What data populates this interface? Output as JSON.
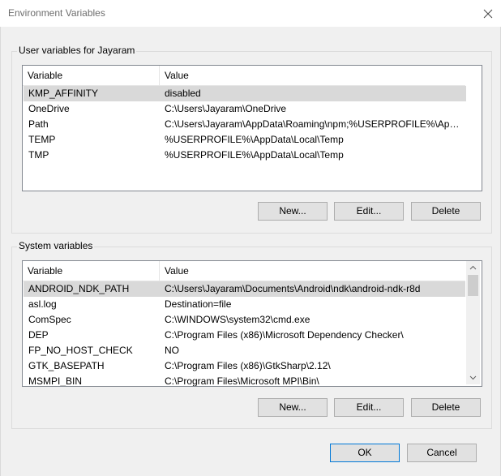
{
  "window": {
    "title": "Environment Variables"
  },
  "user_vars": {
    "group_label": "User variables for Jayaram",
    "columns": [
      "Variable",
      "Value"
    ],
    "rows": [
      {
        "variable": "KMP_AFFINITY",
        "value": "disabled",
        "selected": true
      },
      {
        "variable": "OneDrive",
        "value": "C:\\Users\\Jayaram\\OneDrive"
      },
      {
        "variable": "Path",
        "value": "C:\\Users\\Jayaram\\AppData\\Roaming\\npm;%USERPROFILE%\\AppD..."
      },
      {
        "variable": "TEMP",
        "value": "%USERPROFILE%\\AppData\\Local\\Temp"
      },
      {
        "variable": "TMP",
        "value": "%USERPROFILE%\\AppData\\Local\\Temp"
      }
    ],
    "buttons": {
      "new": "New...",
      "edit": "Edit...",
      "delete": "Delete"
    }
  },
  "system_vars": {
    "group_label": "System variables",
    "columns": [
      "Variable",
      "Value"
    ],
    "rows": [
      {
        "variable": "ANDROID_NDK_PATH",
        "value": "C:\\Users\\Jayaram\\Documents\\Android\\ndk\\android-ndk-r8d",
        "selected": true
      },
      {
        "variable": "asl.log",
        "value": "Destination=file"
      },
      {
        "variable": "ComSpec",
        "value": "C:\\WINDOWS\\system32\\cmd.exe"
      },
      {
        "variable": "DEP",
        "value": "C:\\Program Files (x86)\\Microsoft Dependency Checker\\"
      },
      {
        "variable": "FP_NO_HOST_CHECK",
        "value": "NO"
      },
      {
        "variable": "GTK_BASEPATH",
        "value": "C:\\Program Files (x86)\\GtkSharp\\2.12\\"
      },
      {
        "variable": "MSMPI_BIN",
        "value": "C:\\Program Files\\Microsoft MPI\\Bin\\"
      }
    ],
    "buttons": {
      "new": "New...",
      "edit": "Edit...",
      "delete": "Delete"
    },
    "scroll_fraction": 0.0
  },
  "footer": {
    "ok": "OK",
    "cancel": "Cancel"
  },
  "icons": {
    "close": "close-icon",
    "scroll_up": "chevron-up-icon",
    "scroll_down": "chevron-down-icon"
  },
  "colors": {
    "selected_row": "#d9d9d9",
    "button_bg": "#e1e1e1",
    "button_border": "#adadad"
  }
}
